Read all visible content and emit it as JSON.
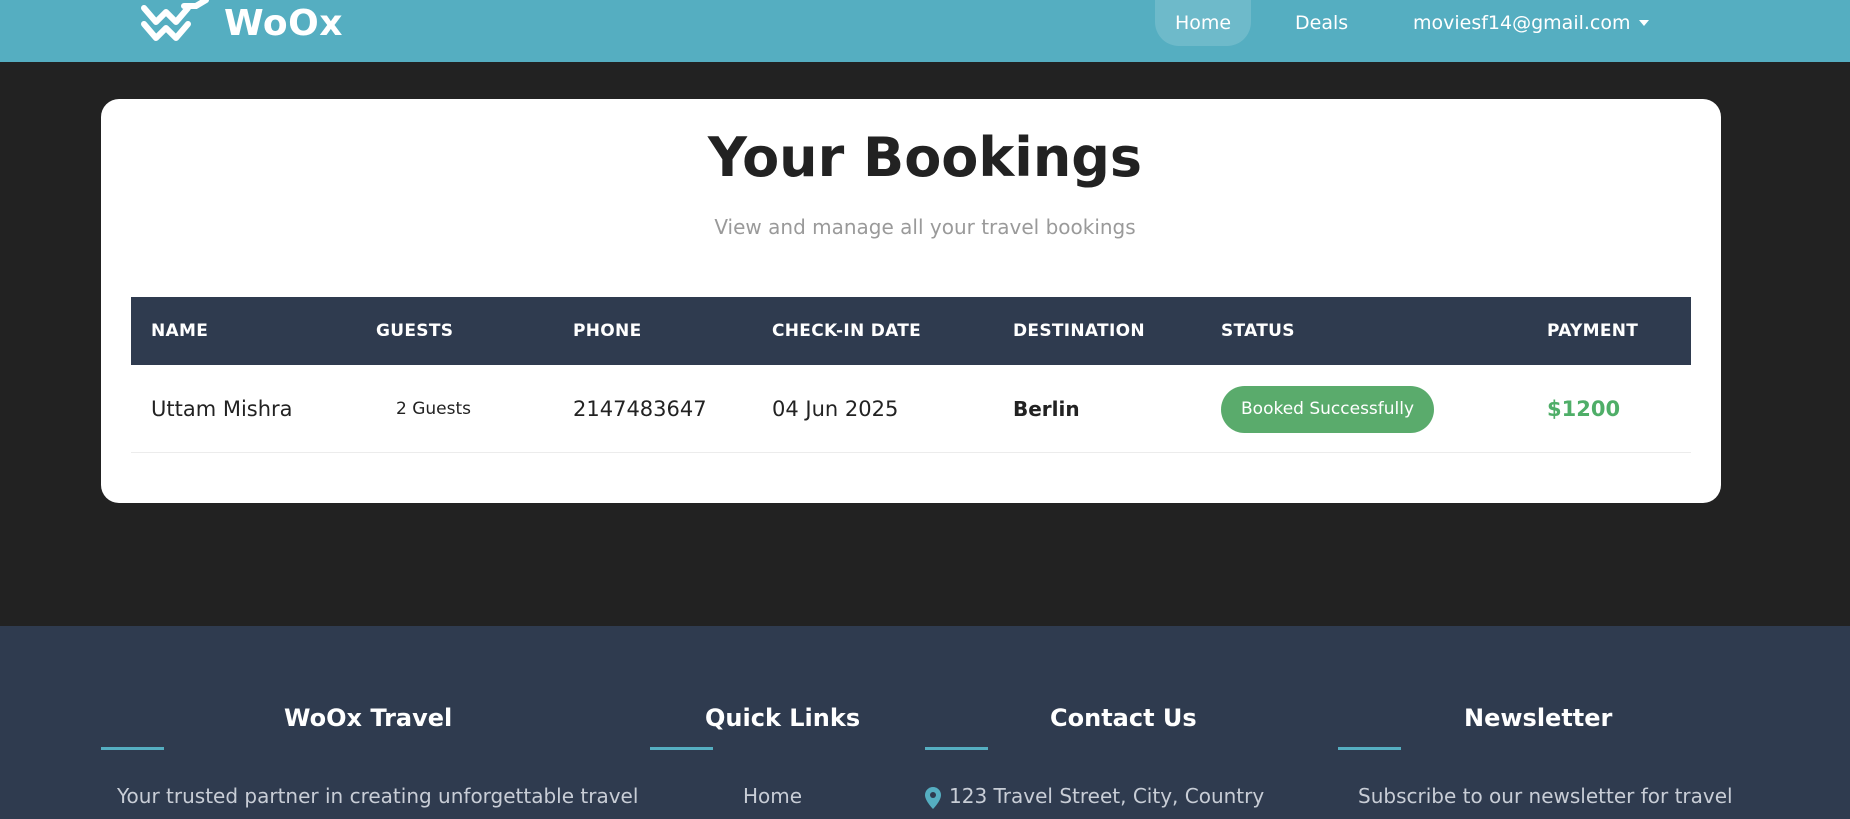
{
  "header": {
    "logo_text": "WoOx",
    "nav": {
      "home": "Home",
      "deals": "Deals",
      "user": "moviesf14@gmail.com"
    }
  },
  "page": {
    "title": "Your Bookings",
    "subtitle": "View and manage all your travel bookings"
  },
  "table": {
    "columns": [
      "NAME",
      "GUESTS",
      "PHONE",
      "CHECK-IN DATE",
      "DESTINATION",
      "STATUS",
      "PAYMENT"
    ],
    "rows": [
      {
        "name": "Uttam Mishra",
        "guests": "2 Guests",
        "phone": "2147483647",
        "checkin": "04 Jun 2025",
        "destination": "Berlin",
        "status": "Booked Successfully",
        "payment": "$1200"
      }
    ]
  },
  "footer": {
    "about": {
      "heading": "WoOx Travel",
      "text": "Your trusted partner in creating unforgettable travel"
    },
    "links": {
      "heading": "Quick Links",
      "items": [
        "Home"
      ]
    },
    "contact": {
      "heading": "Contact Us",
      "address": "123 Travel Street, City, Country"
    },
    "newsletter": {
      "heading": "Newsletter",
      "text": "Subscribe to our newsletter for travel"
    }
  },
  "colors": {
    "header_bg": "#55aec1",
    "table_header_bg": "#2f3b4f",
    "status_badge": "#5aab6c",
    "payment": "#4fae68",
    "footer_bg": "#2f3b4f"
  },
  "icons": [
    "woox-logo-icon",
    "caret-down-icon",
    "map-pin-icon"
  ]
}
